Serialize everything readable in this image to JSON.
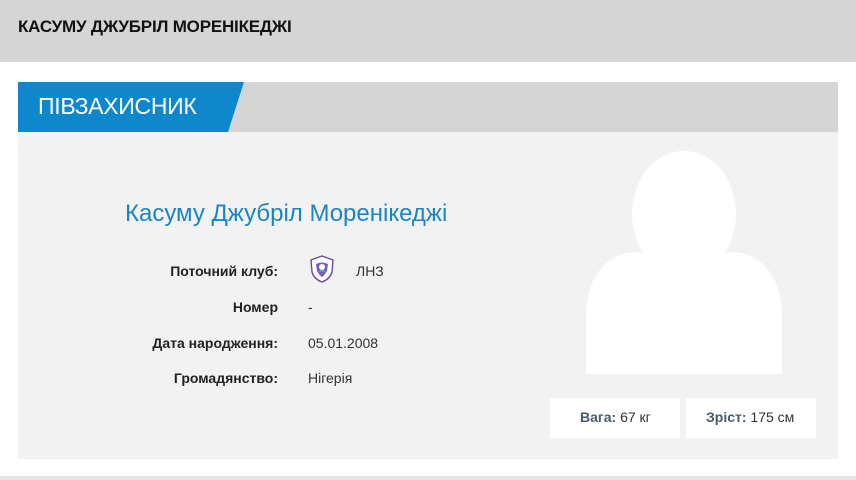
{
  "page": {
    "title": "КАСУМУ ДЖУБРІЛ МОРЕНІКЕДЖІ"
  },
  "card": {
    "position": "ПІВЗАХИСНИК",
    "player_name": "Касуму Джубріл Моренікеджі",
    "details": {
      "club_label": "Поточний клуб:",
      "club_value": "ЛНЗ",
      "number_label": "Номер",
      "number_value": "-",
      "birth_label": "Дата народження:",
      "birth_value": "05.01.2008",
      "citizenship_label": "Громадянство:",
      "citizenship_value": "Нігерія"
    },
    "stats": {
      "weight_label": "Вага:",
      "weight_value": "67 кг",
      "height_label": "Зріст:",
      "height_value": "175 см"
    }
  },
  "colors": {
    "accent": "#0f87cc",
    "name": "#1a85c4",
    "header_bg": "#d5d5d5",
    "card_bg": "#f2f2f2"
  },
  "icons": {
    "club_logo": "club-crest-icon",
    "avatar": "user-silhouette-icon"
  }
}
